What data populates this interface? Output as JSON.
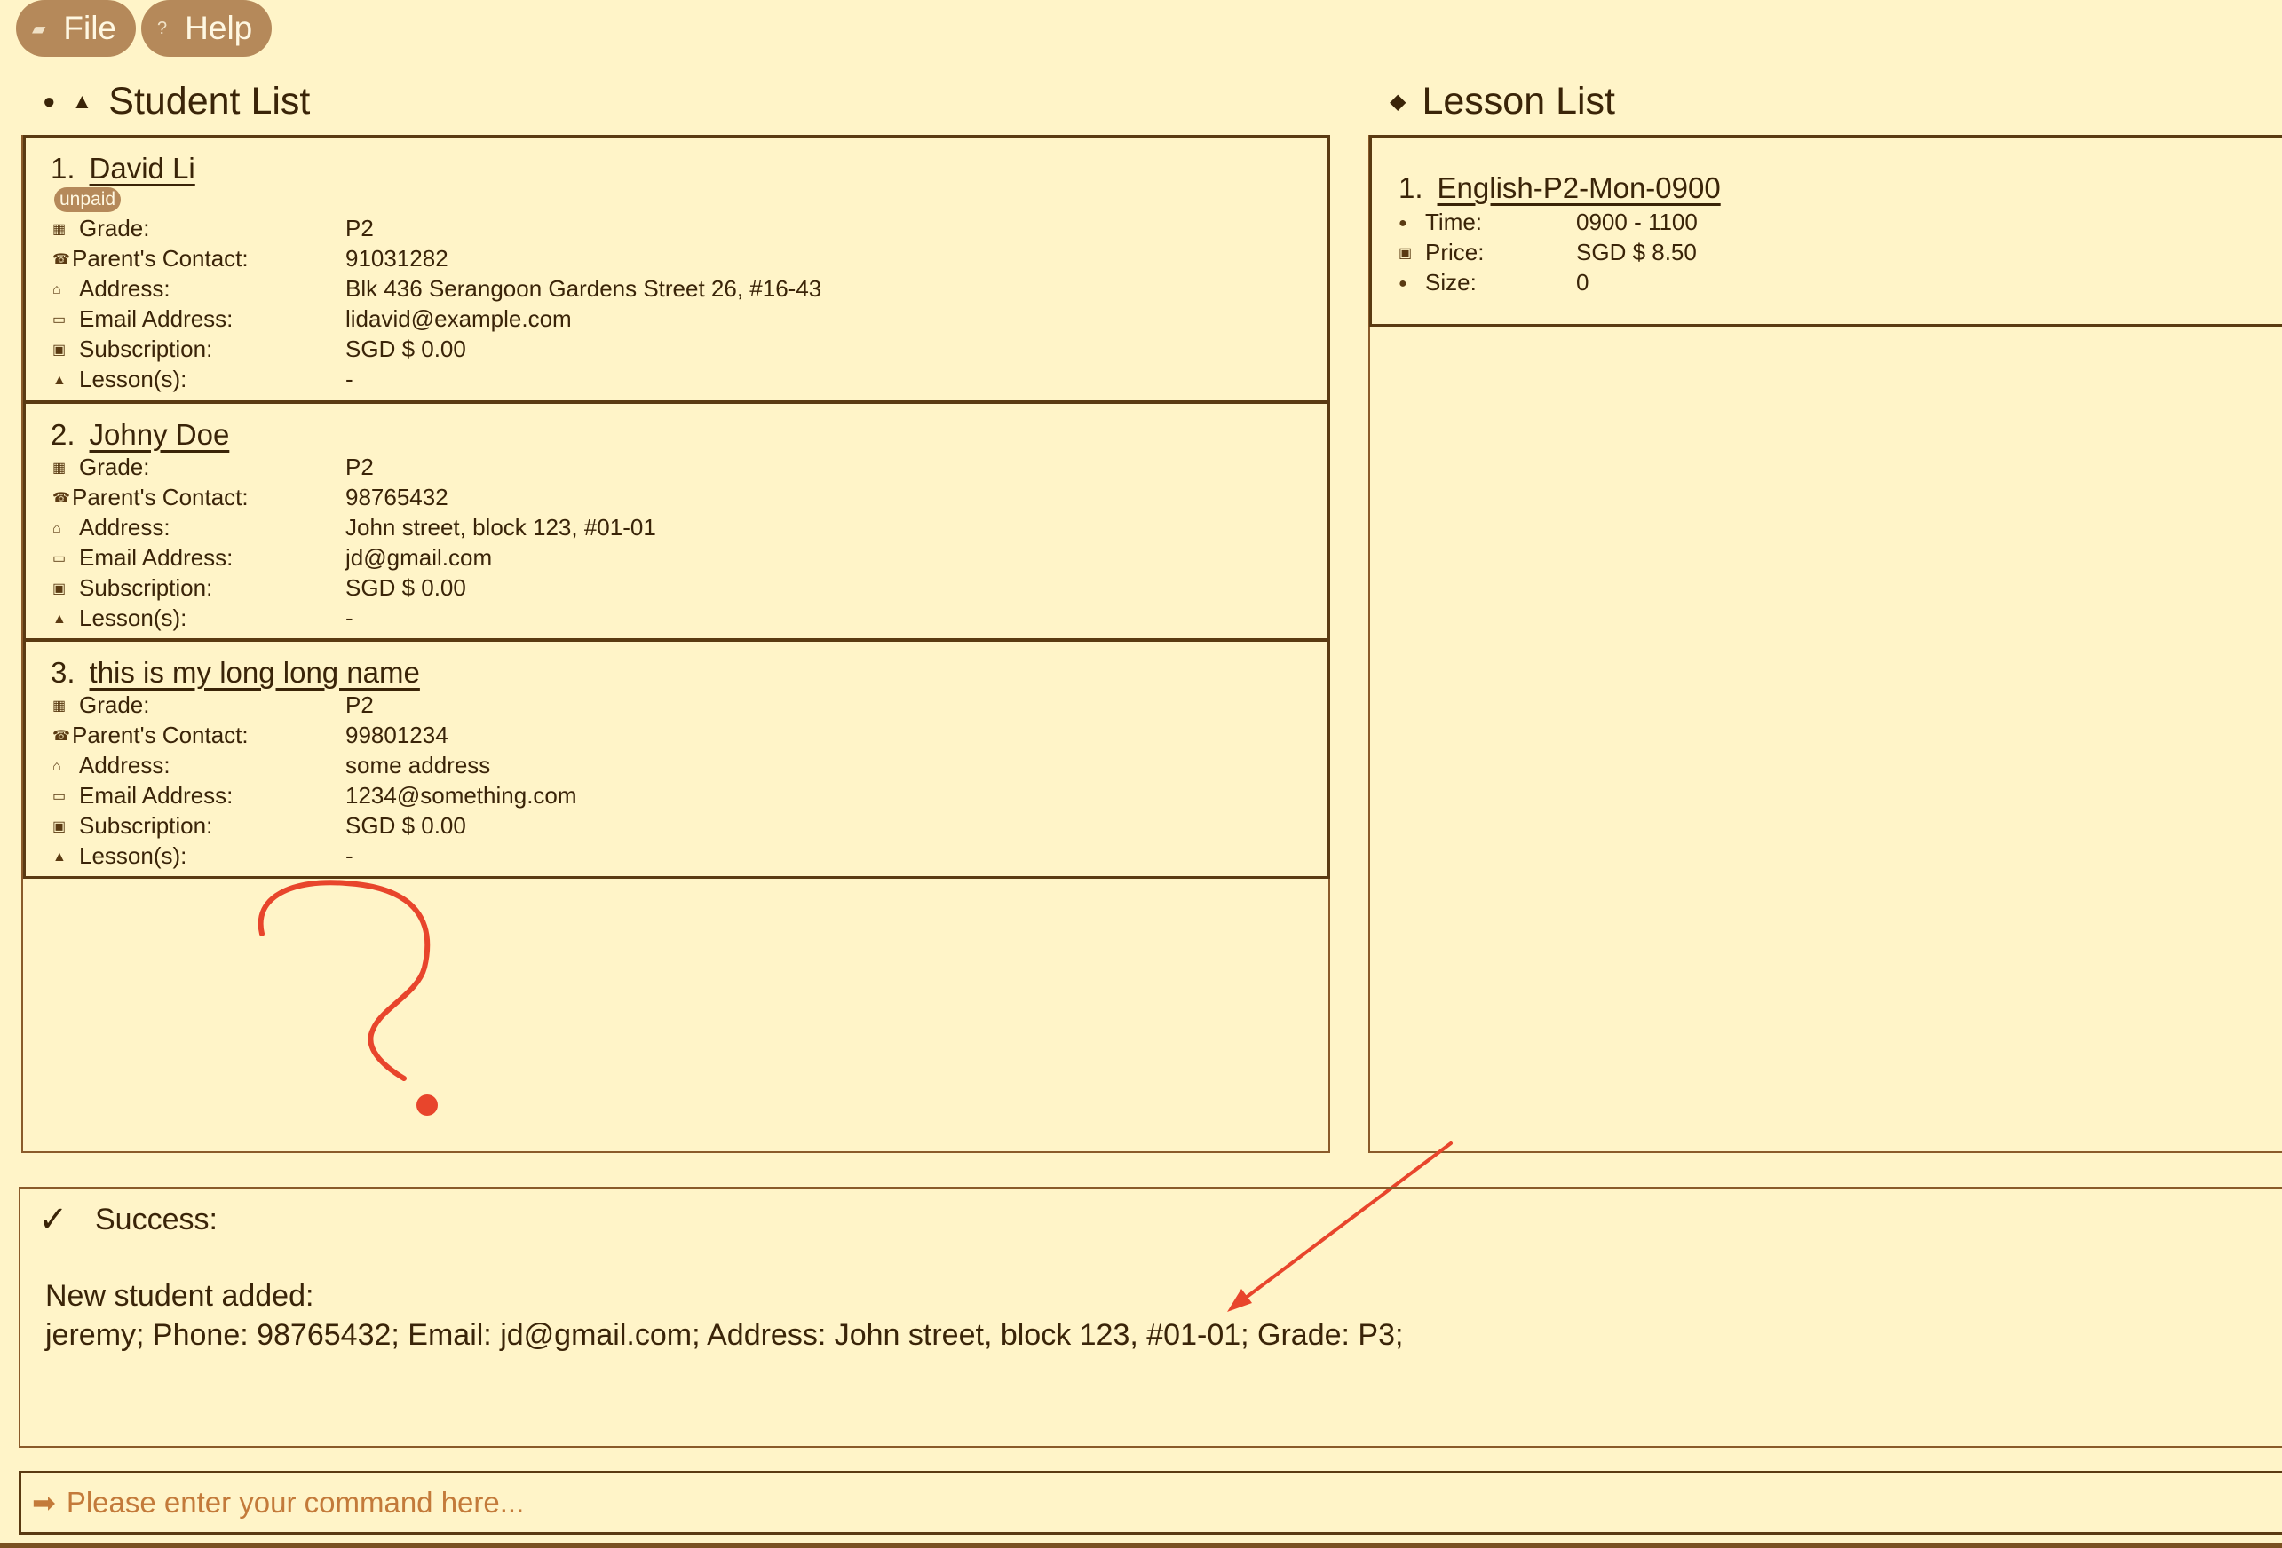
{
  "menu": {
    "file_label": "File",
    "help_label": "Help"
  },
  "student_panel": {
    "title": "Student List"
  },
  "lesson_panel": {
    "title": "Lesson List"
  },
  "students": [
    {
      "index": "1.",
      "name": "David Li",
      "tag": "unpaid",
      "fields": [
        {
          "label": "Grade:",
          "value": "P2"
        },
        {
          "label": "Parent's Contact:",
          "value": "91031282"
        },
        {
          "label": "Address:",
          "value": "Blk 436 Serangoon Gardens Street 26, #16-43"
        },
        {
          "label": "Email Address:",
          "value": "lidavid@example.com"
        },
        {
          "label": "Subscription:",
          "value": "SGD $ 0.00"
        },
        {
          "label": "Lesson(s):",
          "value": "-"
        }
      ]
    },
    {
      "index": "2.",
      "name": "Johny Doe",
      "fields": [
        {
          "label": "Grade:",
          "value": "P2"
        },
        {
          "label": "Parent's Contact:",
          "value": "98765432"
        },
        {
          "label": "Address:",
          "value": "John street, block 123, #01-01"
        },
        {
          "label": "Email Address:",
          "value": "jd@gmail.com"
        },
        {
          "label": "Subscription:",
          "value": "SGD $ 0.00"
        },
        {
          "label": "Lesson(s):",
          "value": "-"
        }
      ]
    },
    {
      "index": "3.",
      "name": "this is my long long name",
      "fields": [
        {
          "label": "Grade:",
          "value": "P2"
        },
        {
          "label": "Parent's Contact:",
          "value": "99801234"
        },
        {
          "label": "Address:",
          "value": "some address"
        },
        {
          "label": "Email Address:",
          "value": "1234@something.com"
        },
        {
          "label": "Subscription:",
          "value": "SGD $ 0.00"
        },
        {
          "label": "Lesson(s):",
          "value": "-"
        }
      ]
    }
  ],
  "lessons": [
    {
      "index": "1.",
      "name": "English-P2-Mon-0900",
      "fields": [
        {
          "label": "Time:",
          "value": "0900 - 1100"
        },
        {
          "label": "Price:",
          "value": "SGD $ 8.50"
        },
        {
          "label": "Size:",
          "value": "0"
        }
      ]
    }
  ],
  "result": {
    "check": "✓",
    "title": "Success:",
    "line1": "New student added:",
    "line2": "jeremy; Phone: 98765432; Email: jd@gmail.com; Address: John street, block 123, #01-01; Grade: P3;"
  },
  "command": {
    "arrow": "➡",
    "placeholder": "Please enter your command here..."
  },
  "colors": {
    "background": "#fff4c8",
    "menu_button": "#b5895a",
    "annotation": "#e8452c"
  }
}
